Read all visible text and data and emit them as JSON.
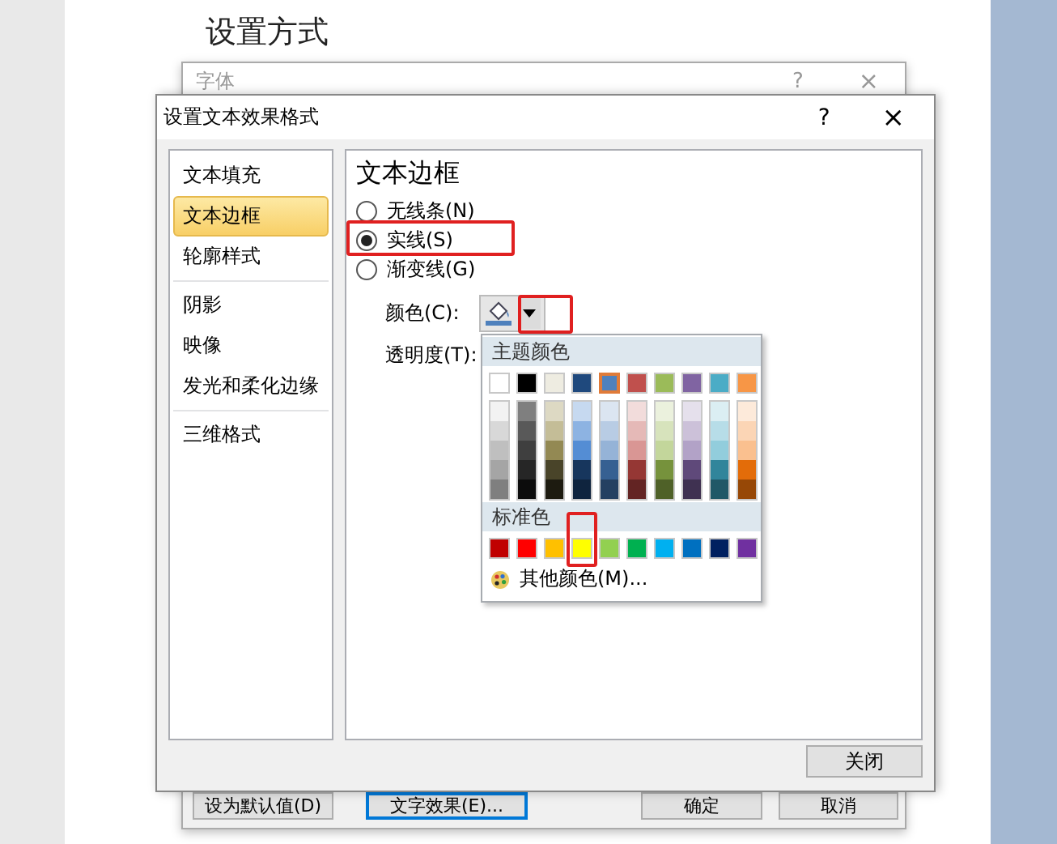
{
  "document": {
    "heading": "设置方式"
  },
  "back_dialog": {
    "title": "字体",
    "help": "?",
    "close": "×",
    "buttons": [
      {
        "label": "设为默认值(D)",
        "focused": false
      },
      {
        "label": "文字效果(E)...",
        "focused": true
      },
      {
        "label": "确定",
        "focused": false
      },
      {
        "label": "取消",
        "focused": false
      }
    ]
  },
  "dialog": {
    "title": "设置文本效果格式",
    "help": "?",
    "close": "×",
    "sidebar": {
      "groups": [
        [
          {
            "label": "文本填充",
            "selected": false
          },
          {
            "label": "文本边框",
            "selected": true
          },
          {
            "label": "轮廓样式",
            "selected": false
          }
        ],
        [
          {
            "label": "阴影",
            "selected": false
          },
          {
            "label": "映像",
            "selected": false
          },
          {
            "label": "发光和柔化边缘",
            "selected": false
          }
        ],
        [
          {
            "label": "三维格式",
            "selected": false
          }
        ]
      ]
    },
    "panel": {
      "heading": "文本边框",
      "options": [
        {
          "label": "无线条(N)",
          "selected": false,
          "highlighted": false
        },
        {
          "label": "实线(S)",
          "selected": true,
          "highlighted": true
        },
        {
          "label": "渐变线(G)",
          "selected": false,
          "highlighted": false
        }
      ],
      "color_label": "颜色(C):",
      "color_button": {
        "highlighted": true
      },
      "transparency_label": "透明度(T):"
    },
    "close_button": "关闭"
  },
  "color_menu": {
    "theme_title": "主题颜色",
    "theme": [
      {
        "color": "#ffffff",
        "selected": false,
        "highlighted": false,
        "shades": [
          {
            "color": "#f2f2f2"
          },
          {
            "color": "#d8d8d8"
          },
          {
            "color": "#bfbfbf"
          },
          {
            "color": "#a5a5a5"
          },
          {
            "color": "#7f7f7f"
          }
        ]
      },
      {
        "color": "#000000",
        "selected": false,
        "highlighted": false,
        "shades": [
          {
            "color": "#7f7f7f"
          },
          {
            "color": "#595959"
          },
          {
            "color": "#3f3f3f"
          },
          {
            "color": "#262626"
          },
          {
            "color": "#0c0c0c"
          }
        ]
      },
      {
        "color": "#eeece1",
        "selected": false,
        "highlighted": false,
        "shades": [
          {
            "color": "#ddd9c3"
          },
          {
            "color": "#c4bd97"
          },
          {
            "color": "#938953"
          },
          {
            "color": "#494429"
          },
          {
            "color": "#1d1b10"
          }
        ]
      },
      {
        "color": "#1f497d",
        "selected": false,
        "highlighted": false,
        "shades": [
          {
            "color": "#c6d9f0"
          },
          {
            "color": "#8db3e2"
          },
          {
            "color": "#548dd4"
          },
          {
            "color": "#17365d"
          },
          {
            "color": "#0f243e"
          }
        ]
      },
      {
        "color": "#4f81bd",
        "selected": true,
        "highlighted": false,
        "shades": [
          {
            "color": "#dbe5f1"
          },
          {
            "color": "#b8cce4"
          },
          {
            "color": "#95b3d7"
          },
          {
            "color": "#366092"
          },
          {
            "color": "#244061"
          }
        ]
      },
      {
        "color": "#c0504d",
        "selected": false,
        "highlighted": false,
        "shades": [
          {
            "color": "#f2dcdb"
          },
          {
            "color": "#e5b9b7"
          },
          {
            "color": "#d99694"
          },
          {
            "color": "#953734"
          },
          {
            "color": "#632423"
          }
        ]
      },
      {
        "color": "#9bbb59",
        "selected": false,
        "highlighted": false,
        "shades": [
          {
            "color": "#ebf1dd"
          },
          {
            "color": "#d7e3bc"
          },
          {
            "color": "#c3d69b"
          },
          {
            "color": "#76923c"
          },
          {
            "color": "#4f6128"
          }
        ]
      },
      {
        "color": "#8064a2",
        "selected": false,
        "highlighted": false,
        "shades": [
          {
            "color": "#e5e0ec"
          },
          {
            "color": "#ccc1d9"
          },
          {
            "color": "#b2a2c7"
          },
          {
            "color": "#5f497a"
          },
          {
            "color": "#3f3151"
          }
        ]
      },
      {
        "color": "#4bacc6",
        "selected": false,
        "highlighted": false,
        "shades": [
          {
            "color": "#dbeef3"
          },
          {
            "color": "#b7dde8"
          },
          {
            "color": "#92cddc"
          },
          {
            "color": "#31859b"
          },
          {
            "color": "#205867"
          }
        ]
      },
      {
        "color": "#f79646",
        "selected": false,
        "highlighted": false,
        "shades": [
          {
            "color": "#fdeada"
          },
          {
            "color": "#fbd5b5"
          },
          {
            "color": "#fac08f"
          },
          {
            "color": "#e36c09"
          },
          {
            "color": "#974806"
          }
        ]
      }
    ],
    "standard_title": "标准色",
    "standard": [
      {
        "color": "#c00000",
        "selected": false,
        "highlighted": false
      },
      {
        "color": "#ff0000",
        "selected": false,
        "highlighted": false
      },
      {
        "color": "#ffc000",
        "selected": false,
        "highlighted": false
      },
      {
        "color": "#ffff00",
        "selected": false,
        "highlighted": true
      },
      {
        "color": "#92d050",
        "selected": false,
        "highlighted": false
      },
      {
        "color": "#00b050",
        "selected": false,
        "highlighted": false
      },
      {
        "color": "#00b0f0",
        "selected": false,
        "highlighted": false
      },
      {
        "color": "#0070c0",
        "selected": false,
        "highlighted": false
      },
      {
        "color": "#002060",
        "selected": false,
        "highlighted": false
      },
      {
        "color": "#7030a0",
        "selected": false,
        "highlighted": false
      }
    ],
    "more_colors": "其他颜色(M)..."
  }
}
